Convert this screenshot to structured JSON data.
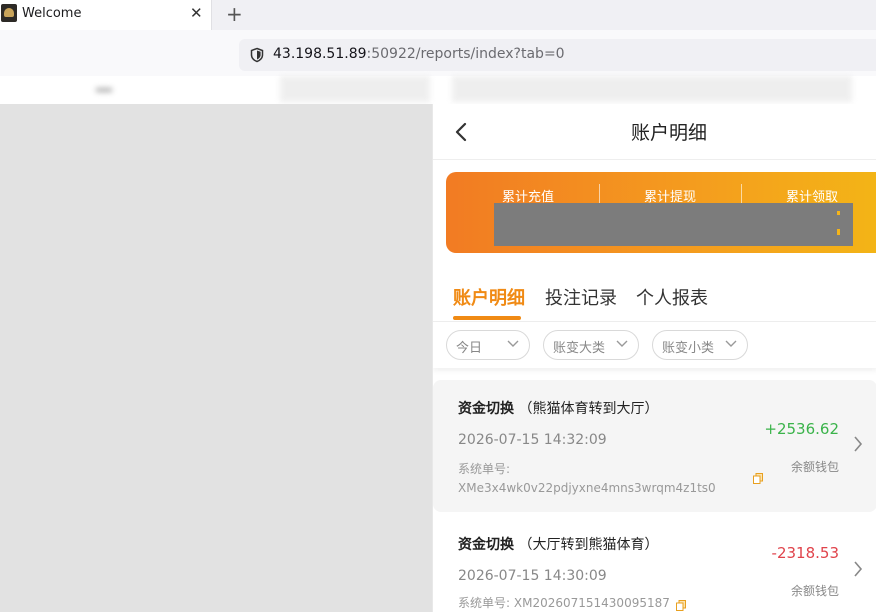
{
  "browser": {
    "tab_title": "Welcome",
    "tab_close": "✕",
    "new_tab": "+",
    "url_host": "43.198.51.89",
    "url_rest": ":50922/reports/index?tab=0"
  },
  "page": {
    "back": "‹",
    "title": "账户明细"
  },
  "banner": {
    "stats": [
      "累计充值",
      "累计提现",
      "累计领取"
    ]
  },
  "tabs": [
    "账户明细",
    "投注记录",
    "个人报表"
  ],
  "filters": [
    "今日",
    "账变大类",
    "账变小类"
  ],
  "records": [
    {
      "type": "资金切换",
      "detail": "（熊猫体育转到大厅）",
      "date": "2026-07-15 14:32:09",
      "order_label": "系统单号:",
      "order_no": "XMe3x4wk0v22pdjyxne4mns3wrqm4z1ts0",
      "amount": "+2536.62",
      "wallet": "余额钱包"
    },
    {
      "type": "资金切换",
      "detail": "（大厅转到熊猫体育）",
      "date": "2026-07-15 14:30:09",
      "order_label": "系统单号:",
      "order_no": "XM202607151430095187",
      "amount": "-2318.53",
      "wallet": "余额钱包"
    }
  ],
  "colors": {
    "accent": "#f08a14",
    "positive": "#3ab34a",
    "negative": "#e0434b"
  }
}
